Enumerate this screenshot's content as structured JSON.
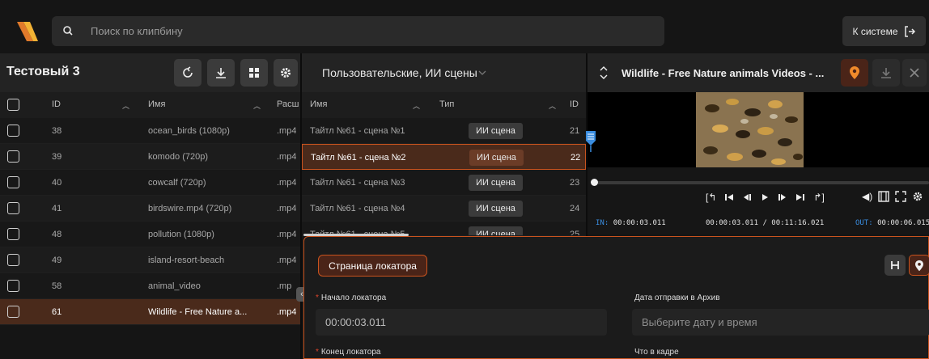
{
  "search": {
    "placeholder": "Поиск по клипбину"
  },
  "system_button": {
    "label": "К системе"
  },
  "left_panel": {
    "title": "Тестовый 3",
    "columns": {
      "id": "ID",
      "name": "Имя",
      "ext": "Расш"
    },
    "rows": [
      {
        "id": "38",
        "name": "ocean_birds (1080p)",
        "ext": ".mp4"
      },
      {
        "id": "39",
        "name": "komodo (720p)",
        "ext": ".mp4"
      },
      {
        "id": "40",
        "name": "cowcalf (720p)",
        "ext": ".mp4"
      },
      {
        "id": "41",
        "name": "birdswire.mp4 (720p)",
        "ext": ".mp4"
      },
      {
        "id": "48",
        "name": "pollution (1080p)",
        "ext": ".mp4"
      },
      {
        "id": "49",
        "name": "island-resort-beach",
        "ext": ".mp4"
      },
      {
        "id": "58",
        "name": "animal_video",
        "ext": ".mp"
      },
      {
        "id": "61",
        "name": "Wildlife - Free Nature a...",
        "ext": ".mp4"
      }
    ]
  },
  "middle_panel": {
    "title": "Пользовательские, ИИ сцены",
    "columns": {
      "name": "Имя",
      "type": "Тип",
      "id": "ID"
    },
    "rows": [
      {
        "name": "Тайтл №61 - сцена №1",
        "type": "ИИ сцена",
        "id": "21"
      },
      {
        "name": "Тайтл №61 - сцена №2",
        "type": "ИИ сцена",
        "id": "22"
      },
      {
        "name": "Тайтл №61 - сцена №3",
        "type": "ИИ сцена",
        "id": "23"
      },
      {
        "name": "Тайтл №61 - сцена №4",
        "type": "ИИ сцена",
        "id": "24"
      },
      {
        "name": "Тайтл №61 - сцена №5",
        "type": "ИИ сцена",
        "id": "25"
      }
    ]
  },
  "player": {
    "title": "Wildlife - Free Nature animals Videos - ...",
    "in": "00:00:03.011",
    "in_label": "IN:",
    "position": "00:00:03.011 / 00:11:16.021",
    "out": "00:00:06.015",
    "out_label": "OUT:"
  },
  "locator": {
    "page_label": "Страница локатора",
    "start_label": "Начало локатора",
    "start_value": "00:00:03.011",
    "archive_label": "Дата отправки в Архив",
    "archive_placeholder": "Выберите дату и время",
    "end_label": "Конец локатора",
    "frame_label": "Что в кадре"
  },
  "colors": {
    "accent": "#e0652b",
    "selected_row": "#4a2a1b",
    "marker": "#3a8de0"
  }
}
